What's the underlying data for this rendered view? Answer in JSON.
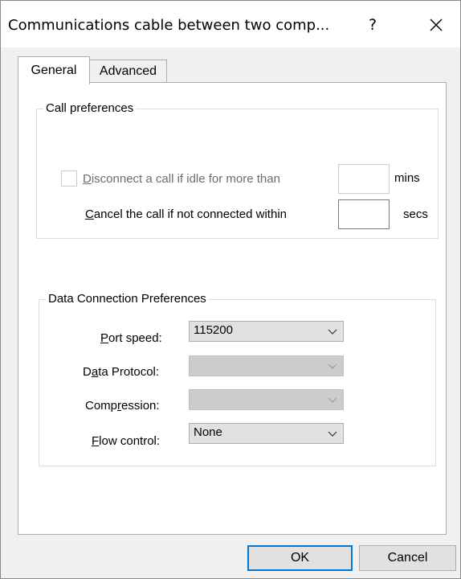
{
  "window": {
    "title": "Communications cable between two comp...",
    "help_label": "?",
    "close_icon": "close-icon"
  },
  "tabs": [
    {
      "label": "General",
      "active": true
    },
    {
      "label": "Advanced",
      "active": false
    }
  ],
  "call_preferences": {
    "group_title": "Call preferences",
    "disconnect": {
      "pre": "",
      "accel": "D",
      "post": "isconnect a call if idle for more than",
      "checked": false,
      "enabled": false,
      "value": "",
      "unit": "mins"
    },
    "cancel": {
      "accel": "C",
      "post": "ancel the call if not connected within",
      "value": "",
      "unit": "secs"
    }
  },
  "data_connection": {
    "group_title": "Data Connection Preferences",
    "port_speed": {
      "accel": "P",
      "post": "ort speed:",
      "value": "115200",
      "enabled": true
    },
    "data_protocol": {
      "pre": "D",
      "accel": "a",
      "post": "ta Protocol:",
      "value": "",
      "enabled": false
    },
    "compression": {
      "pre": "Comp",
      "accel": "r",
      "post": "ession:",
      "value": "",
      "enabled": false
    },
    "flow_control": {
      "accel": "F",
      "post": "low control:",
      "value": "None",
      "enabled": true
    }
  },
  "buttons": {
    "ok": "OK",
    "cancel": "Cancel"
  },
  "colors": {
    "accent": "#0078d7",
    "disabled_text": "#6d6d6d"
  }
}
